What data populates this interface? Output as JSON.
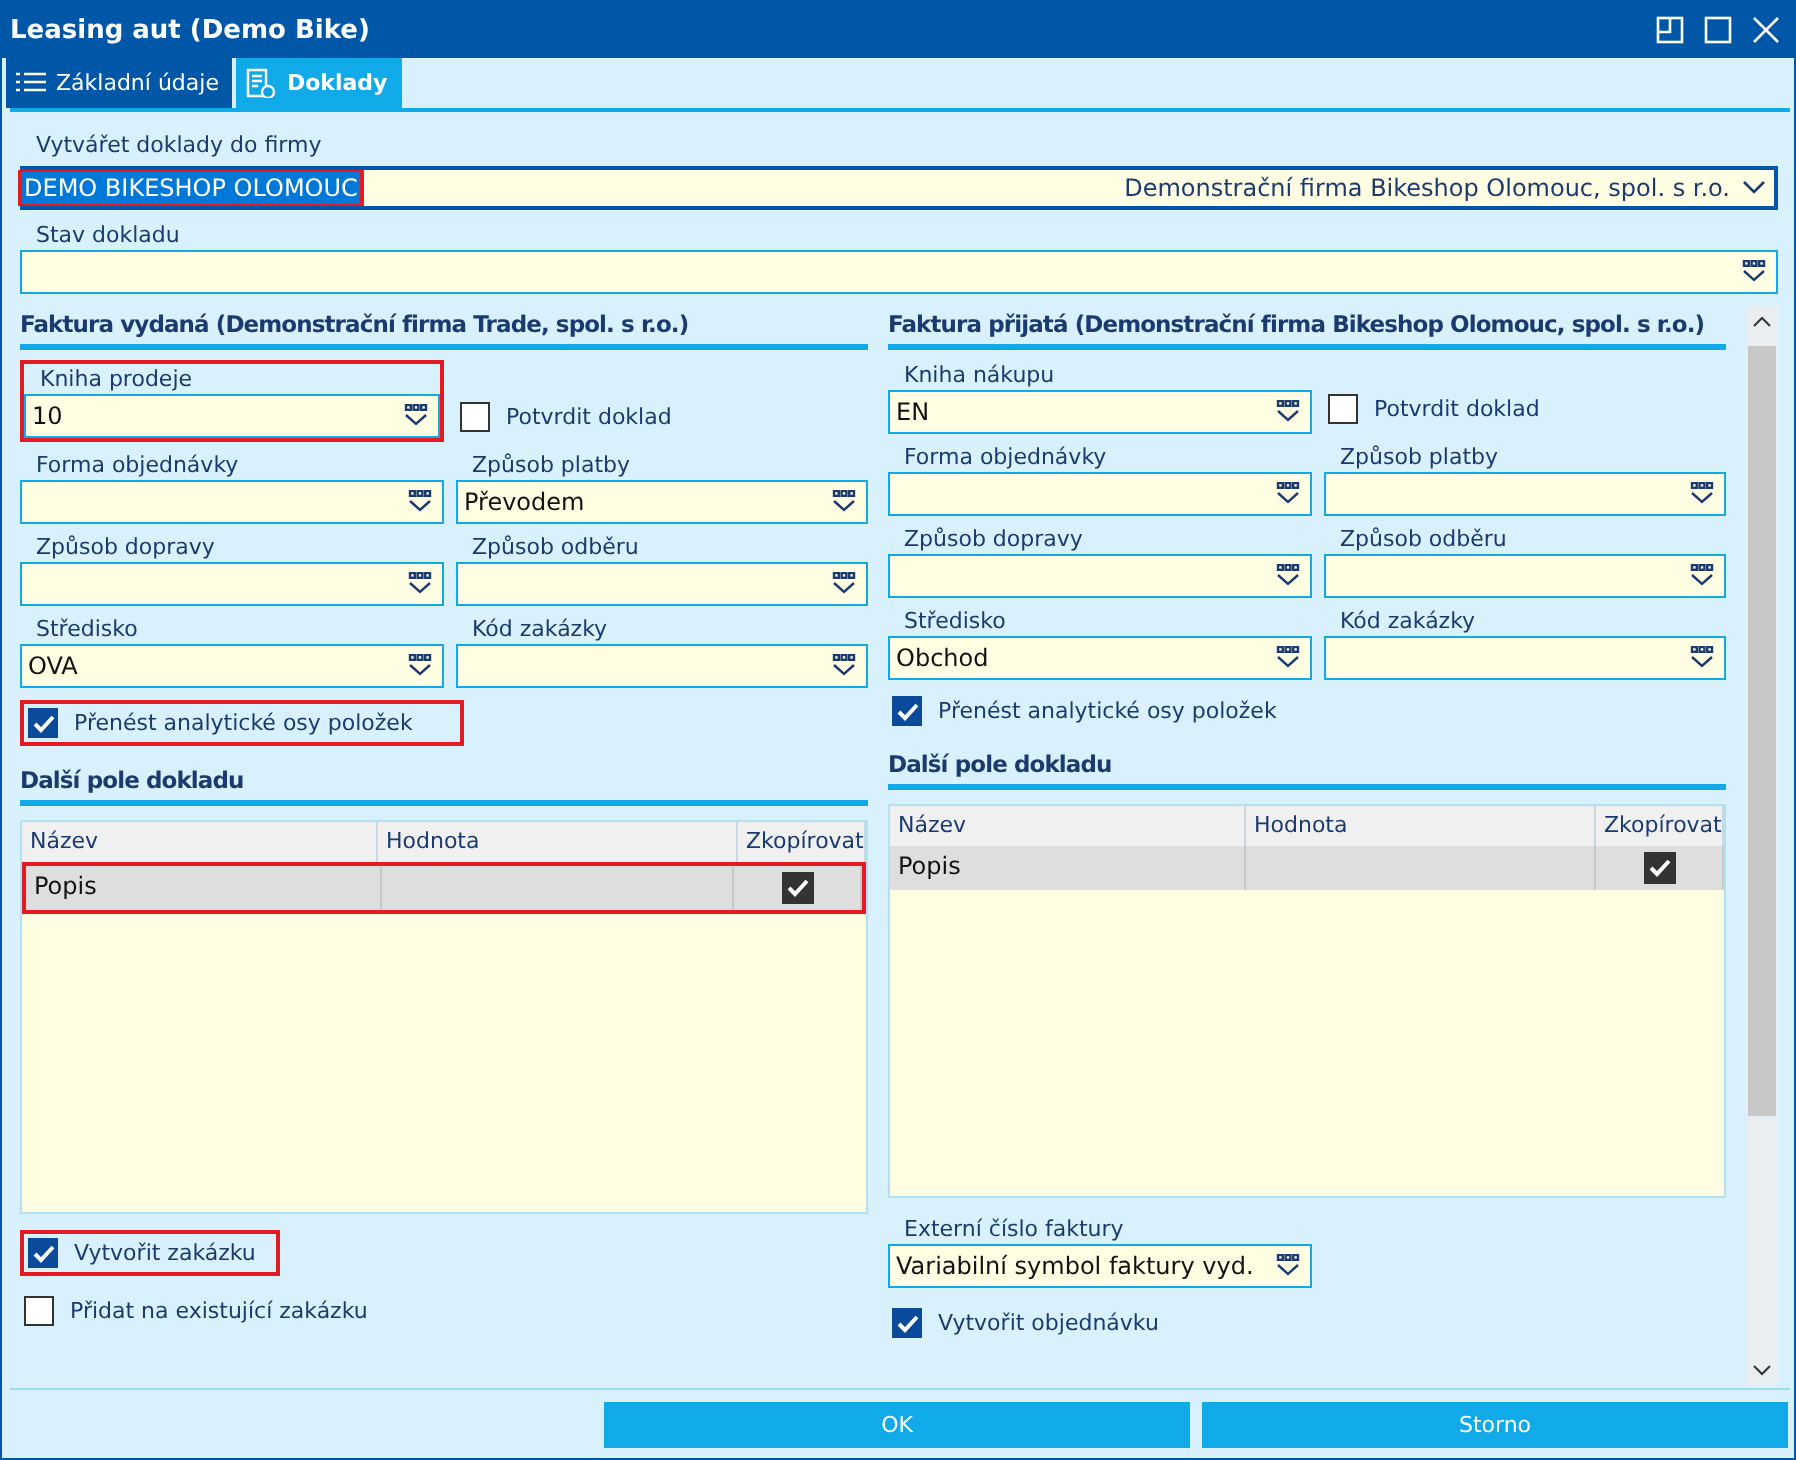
{
  "window": {
    "title": "Leasing aut (Demo Bike)"
  },
  "tabs": [
    {
      "label": "Základní údaje",
      "kind": "list",
      "selected": false
    },
    {
      "label": "Doklady",
      "kind": "document",
      "selected": true
    }
  ],
  "company": {
    "label": "Vytvářet doklady do firmy",
    "value": "DEMO BIKESHOP OLOMOUC",
    "value_selected": true,
    "description": "Demonstrační firma Bikeshop Olomouc, spol. s r.o.",
    "highlighted": true
  },
  "status_field": {
    "label": "Stav dokladu"
  },
  "sections": [
    {
      "title": "Faktura vydaná (Demonstrační firma Trade, spol. s r.o.)",
      "book": {
        "label": "Kniha prodeje",
        "value": "10",
        "highlighted": true
      },
      "confirm": {
        "label": "Potvrdit doklad",
        "checked": false
      },
      "fields": [
        {
          "label": "Forma objednávky"
        },
        {
          "label": "Způsob platby",
          "value": "Převodem"
        },
        {
          "label": "Způsob dopravy"
        },
        {
          "label": "Způsob odběru"
        },
        {
          "label": "Středisko",
          "value": "OVA"
        },
        {
          "label": "Kód zakázky"
        }
      ],
      "transfer": {
        "label": "Přenést analytické osy položek",
        "checked": true,
        "highlighted": true
      },
      "extra_title": "Další pole dokladu",
      "table": {
        "columns": [
          "Název",
          "Hodnota",
          "Zkopírovat"
        ],
        "rows": [
          {
            "name": "Popis",
            "copy": true,
            "highlighted": true
          }
        ]
      },
      "footer": [
        {
          "kind": "checkbox",
          "label": "Vytvořit zakázku",
          "checked": true,
          "highlighted": true
        },
        {
          "kind": "checkbox",
          "label": "Přidat na existující zakázku",
          "checked": false,
          "highlighted": false
        }
      ]
    },
    {
      "title": "Faktura přijatá (Demonstrační firma Bikeshop Olomouc, spol. s r.o.)",
      "book": {
        "label": "Kniha nákupu",
        "value": "EN",
        "highlighted": false
      },
      "confirm": {
        "label": "Potvrdit doklad",
        "checked": false
      },
      "fields": [
        {
          "label": "Forma objednávky"
        },
        {
          "label": "Způsob platby"
        },
        {
          "label": "Způsob dopravy"
        },
        {
          "label": "Způsob odběru"
        },
        {
          "label": "Středisko",
          "value": "Obchod"
        },
        {
          "label": "Kód zakázky"
        }
      ],
      "transfer": {
        "label": "Přenést analytické osy položek",
        "checked": true,
        "highlighted": false
      },
      "extra_title": "Další pole dokladu",
      "table": {
        "columns": [
          "Název",
          "Hodnota",
          "Zkopírovat"
        ],
        "rows": [
          {
            "name": "Popis",
            "copy": true,
            "highlighted": false
          }
        ]
      },
      "footer": [
        {
          "kind": "select",
          "label": "Externí číslo faktury",
          "value": "Variabilní symbol faktury vyd."
        },
        {
          "kind": "checkbox",
          "label": "Vytvořit objednávku",
          "checked": true,
          "highlighted": false
        }
      ]
    }
  ],
  "buttons": [
    {
      "label": "OK"
    },
    {
      "label": "Storno"
    }
  ]
}
